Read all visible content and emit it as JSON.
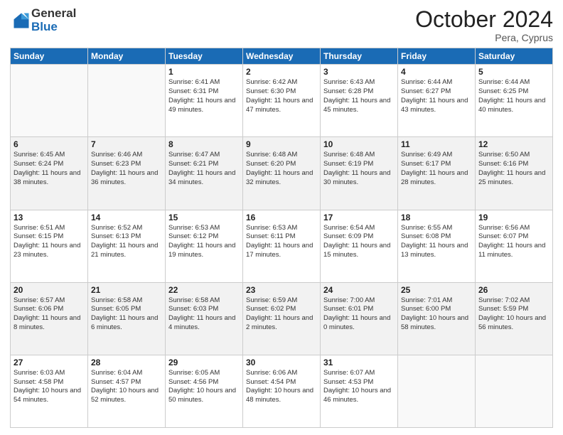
{
  "logo": {
    "general": "General",
    "blue": "Blue"
  },
  "title": "October 2024",
  "location": "Pera, Cyprus",
  "days_header": [
    "Sunday",
    "Monday",
    "Tuesday",
    "Wednesday",
    "Thursday",
    "Friday",
    "Saturday"
  ],
  "weeks": [
    [
      {
        "day": "",
        "info": ""
      },
      {
        "day": "",
        "info": ""
      },
      {
        "day": "1",
        "info": "Sunrise: 6:41 AM\nSunset: 6:31 PM\nDaylight: 11 hours and 49 minutes."
      },
      {
        "day": "2",
        "info": "Sunrise: 6:42 AM\nSunset: 6:30 PM\nDaylight: 11 hours and 47 minutes."
      },
      {
        "day": "3",
        "info": "Sunrise: 6:43 AM\nSunset: 6:28 PM\nDaylight: 11 hours and 45 minutes."
      },
      {
        "day": "4",
        "info": "Sunrise: 6:44 AM\nSunset: 6:27 PM\nDaylight: 11 hours and 43 minutes."
      },
      {
        "day": "5",
        "info": "Sunrise: 6:44 AM\nSunset: 6:25 PM\nDaylight: 11 hours and 40 minutes."
      }
    ],
    [
      {
        "day": "6",
        "info": "Sunrise: 6:45 AM\nSunset: 6:24 PM\nDaylight: 11 hours and 38 minutes."
      },
      {
        "day": "7",
        "info": "Sunrise: 6:46 AM\nSunset: 6:23 PM\nDaylight: 11 hours and 36 minutes."
      },
      {
        "day": "8",
        "info": "Sunrise: 6:47 AM\nSunset: 6:21 PM\nDaylight: 11 hours and 34 minutes."
      },
      {
        "day": "9",
        "info": "Sunrise: 6:48 AM\nSunset: 6:20 PM\nDaylight: 11 hours and 32 minutes."
      },
      {
        "day": "10",
        "info": "Sunrise: 6:48 AM\nSunset: 6:19 PM\nDaylight: 11 hours and 30 minutes."
      },
      {
        "day": "11",
        "info": "Sunrise: 6:49 AM\nSunset: 6:17 PM\nDaylight: 11 hours and 28 minutes."
      },
      {
        "day": "12",
        "info": "Sunrise: 6:50 AM\nSunset: 6:16 PM\nDaylight: 11 hours and 25 minutes."
      }
    ],
    [
      {
        "day": "13",
        "info": "Sunrise: 6:51 AM\nSunset: 6:15 PM\nDaylight: 11 hours and 23 minutes."
      },
      {
        "day": "14",
        "info": "Sunrise: 6:52 AM\nSunset: 6:13 PM\nDaylight: 11 hours and 21 minutes."
      },
      {
        "day": "15",
        "info": "Sunrise: 6:53 AM\nSunset: 6:12 PM\nDaylight: 11 hours and 19 minutes."
      },
      {
        "day": "16",
        "info": "Sunrise: 6:53 AM\nSunset: 6:11 PM\nDaylight: 11 hours and 17 minutes."
      },
      {
        "day": "17",
        "info": "Sunrise: 6:54 AM\nSunset: 6:09 PM\nDaylight: 11 hours and 15 minutes."
      },
      {
        "day": "18",
        "info": "Sunrise: 6:55 AM\nSunset: 6:08 PM\nDaylight: 11 hours and 13 minutes."
      },
      {
        "day": "19",
        "info": "Sunrise: 6:56 AM\nSunset: 6:07 PM\nDaylight: 11 hours and 11 minutes."
      }
    ],
    [
      {
        "day": "20",
        "info": "Sunrise: 6:57 AM\nSunset: 6:06 PM\nDaylight: 11 hours and 8 minutes."
      },
      {
        "day": "21",
        "info": "Sunrise: 6:58 AM\nSunset: 6:05 PM\nDaylight: 11 hours and 6 minutes."
      },
      {
        "day": "22",
        "info": "Sunrise: 6:58 AM\nSunset: 6:03 PM\nDaylight: 11 hours and 4 minutes."
      },
      {
        "day": "23",
        "info": "Sunrise: 6:59 AM\nSunset: 6:02 PM\nDaylight: 11 hours and 2 minutes."
      },
      {
        "day": "24",
        "info": "Sunrise: 7:00 AM\nSunset: 6:01 PM\nDaylight: 11 hours and 0 minutes."
      },
      {
        "day": "25",
        "info": "Sunrise: 7:01 AM\nSunset: 6:00 PM\nDaylight: 10 hours and 58 minutes."
      },
      {
        "day": "26",
        "info": "Sunrise: 7:02 AM\nSunset: 5:59 PM\nDaylight: 10 hours and 56 minutes."
      }
    ],
    [
      {
        "day": "27",
        "info": "Sunrise: 6:03 AM\nSunset: 4:58 PM\nDaylight: 10 hours and 54 minutes."
      },
      {
        "day": "28",
        "info": "Sunrise: 6:04 AM\nSunset: 4:57 PM\nDaylight: 10 hours and 52 minutes."
      },
      {
        "day": "29",
        "info": "Sunrise: 6:05 AM\nSunset: 4:56 PM\nDaylight: 10 hours and 50 minutes."
      },
      {
        "day": "30",
        "info": "Sunrise: 6:06 AM\nSunset: 4:54 PM\nDaylight: 10 hours and 48 minutes."
      },
      {
        "day": "31",
        "info": "Sunrise: 6:07 AM\nSunset: 4:53 PM\nDaylight: 10 hours and 46 minutes."
      },
      {
        "day": "",
        "info": ""
      },
      {
        "day": "",
        "info": ""
      }
    ]
  ]
}
